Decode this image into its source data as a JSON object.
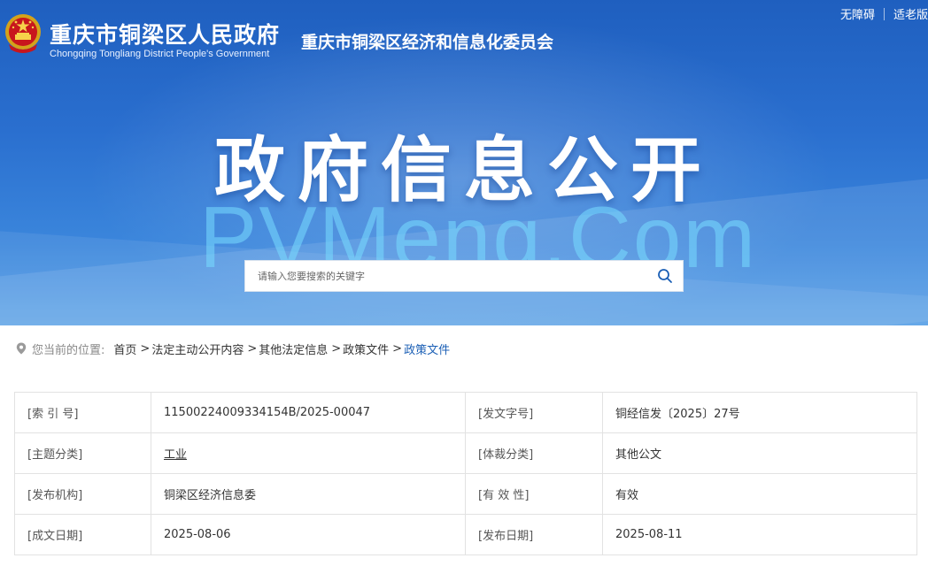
{
  "header": {
    "gov_title": "重庆市铜梁区人民政府",
    "gov_subtitle": "Chongqing Tongliang District People's Government",
    "dept_title": "重庆市铜梁区经济和信息化委员会",
    "top_links": [
      "无障碍",
      "适老版"
    ],
    "emblem_icon": "national-emblem-icon"
  },
  "hero": {
    "title": "政府信息公开",
    "watermark": "PVMeng.Com"
  },
  "search": {
    "placeholder": "请输入您要搜索的关键字",
    "icon": "search-icon"
  },
  "breadcrumb": {
    "label": "您当前的位置:",
    "items": [
      "首页",
      "法定主动公开内容",
      "其他法定信息",
      "政策文件",
      "政策文件"
    ],
    "separator": ">"
  },
  "info_table": {
    "rows": [
      {
        "k1": "[索 引 号]",
        "v1": "11500224009334154B/2025-00047",
        "k2": "[发文字号]",
        "v2": "铜经信发〔2025〕27号"
      },
      {
        "k1": "[主题分类]",
        "v1": "工业",
        "k2": "[体裁分类]",
        "v2": "其他公文"
      },
      {
        "k1": "[发布机构]",
        "v1": "铜梁区经济信息委",
        "k2": "[有 效 性]",
        "v2": "有效"
      },
      {
        "k1": "[成文日期]",
        "v1": "2025-08-06",
        "k2": "[发布日期]",
        "v2": "2025-08-11"
      }
    ]
  },
  "colors": {
    "banner_top": "#1f5fbf",
    "banner_bottom": "#5aa1e6",
    "breadcrumb_current": "#1b5fb5",
    "table_border": "#e2e2e2"
  }
}
